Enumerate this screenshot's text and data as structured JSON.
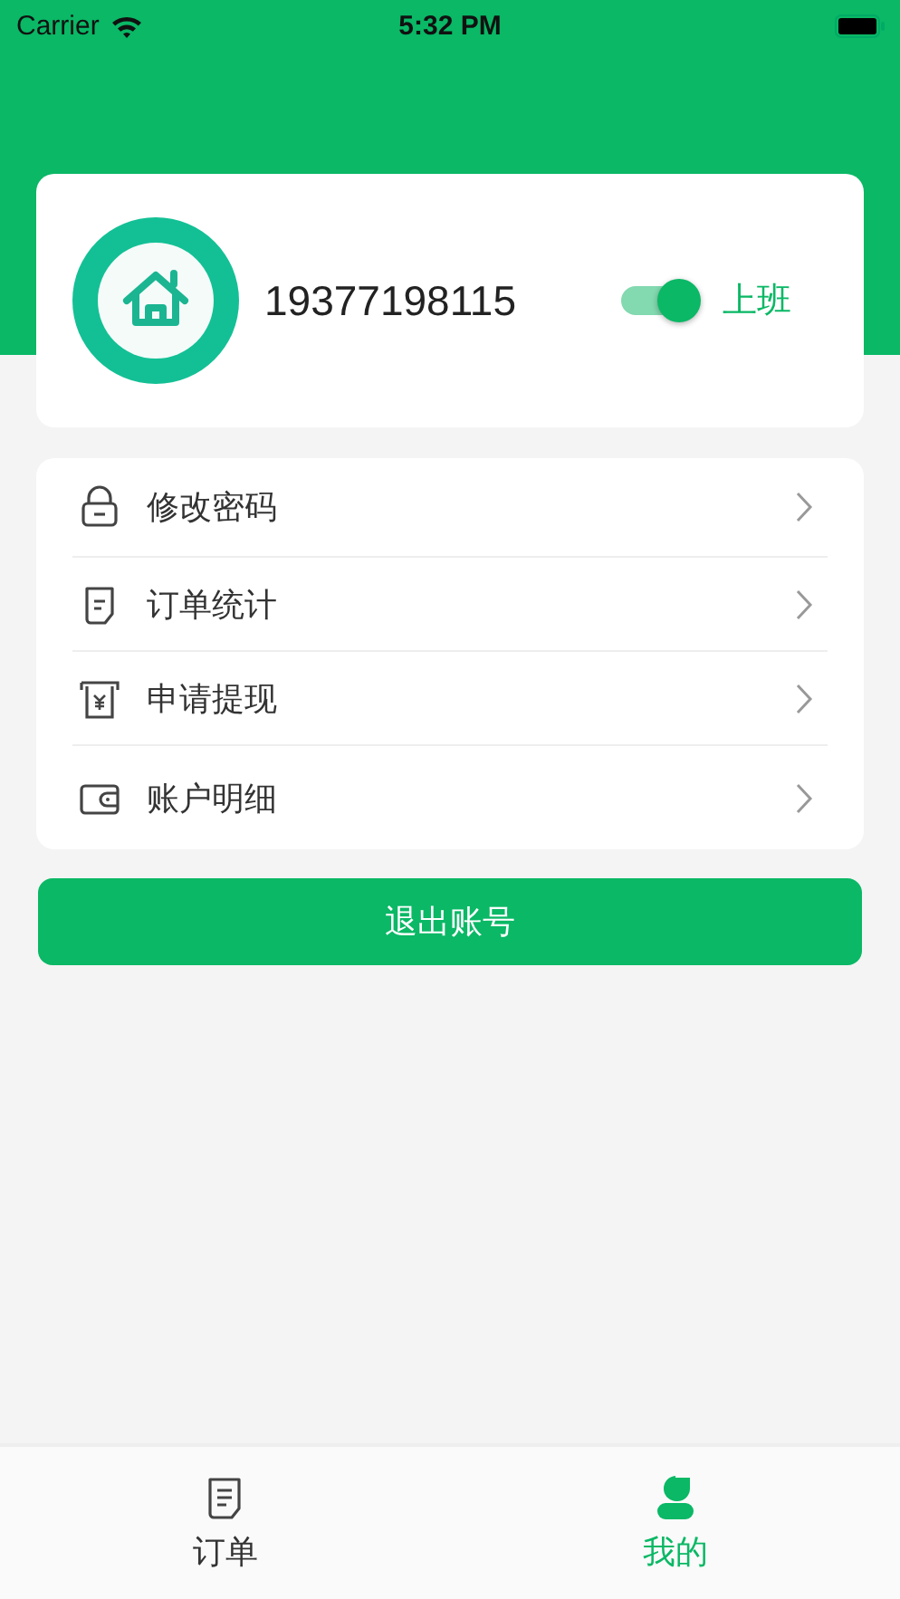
{
  "status_bar": {
    "carrier": "Carrier",
    "time": "5:32 PM"
  },
  "profile": {
    "phone": "19377198115",
    "duty_toggle": {
      "on": true,
      "label": "上班"
    }
  },
  "menu": [
    {
      "kind": "lock",
      "label": "修改密码"
    },
    {
      "kind": "document",
      "label": "订单统计"
    },
    {
      "kind": "cash",
      "label": "申请提现"
    },
    {
      "kind": "wallet",
      "label": "账户明细"
    }
  ],
  "logout_button": "退出账号",
  "tabs": [
    {
      "kind": "orders",
      "label": "订单",
      "selected": false
    },
    {
      "kind": "me",
      "label": "我的",
      "selected": true
    }
  ]
}
